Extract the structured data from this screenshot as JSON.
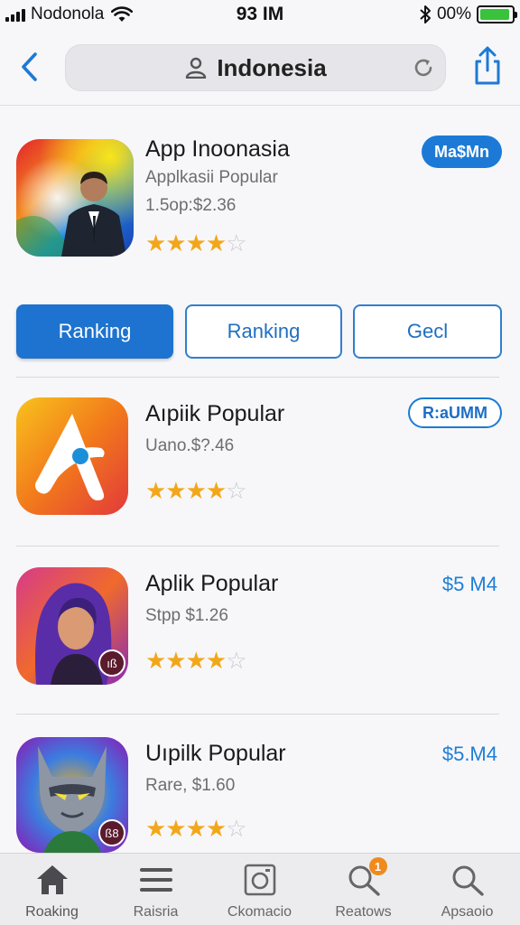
{
  "status": {
    "carrier": "Nodonola",
    "time": "93 IM",
    "battery_text": "00%",
    "battery_level": 0.95
  },
  "nav": {
    "back_icon": "chevron-left-icon",
    "url": "Indonesia",
    "share_icon": "share-icon"
  },
  "featured": {
    "title": "App Inoonasia",
    "subtitle": "Applkasii Popular",
    "meta": "1.5op:$2.36",
    "rating": 3.5,
    "badge": "Ma$Mn"
  },
  "segments": [
    {
      "label": "Ranking",
      "active": true
    },
    {
      "label": "Ranking",
      "active": false
    },
    {
      "label": "Gecl",
      "active": false
    }
  ],
  "apps": [
    {
      "title": "Aıpiik Popular",
      "sub": "Uano.$?.46",
      "rating": 3.5,
      "price": "R:aUMM",
      "price_style": "outline"
    },
    {
      "title": "Aplik Popular",
      "sub": "Stpp $1.26",
      "rating": 3.5,
      "price": "$5 M4",
      "price_style": "text",
      "icon_badge": "ıß"
    },
    {
      "title": "Uıpilk Popular",
      "sub": "Rare, $1.60",
      "rating": 3.5,
      "price": "$5.M4",
      "price_style": "text",
      "icon_badge": "ß8"
    }
  ],
  "tabs": [
    {
      "label": "Roaking",
      "icon": "home-icon"
    },
    {
      "label": "Raisria",
      "icon": "list-icon"
    },
    {
      "label": "Ckomacio",
      "icon": "camera-icon"
    },
    {
      "label": "Reatows",
      "icon": "search-icon",
      "badge": "1"
    },
    {
      "label": "Apsaoio",
      "icon": "search-icon"
    }
  ],
  "colors": {
    "accent": "#1c7ad6",
    "star": "#f2a71b",
    "battery": "#39c23b",
    "badge": "#f08a1c"
  }
}
